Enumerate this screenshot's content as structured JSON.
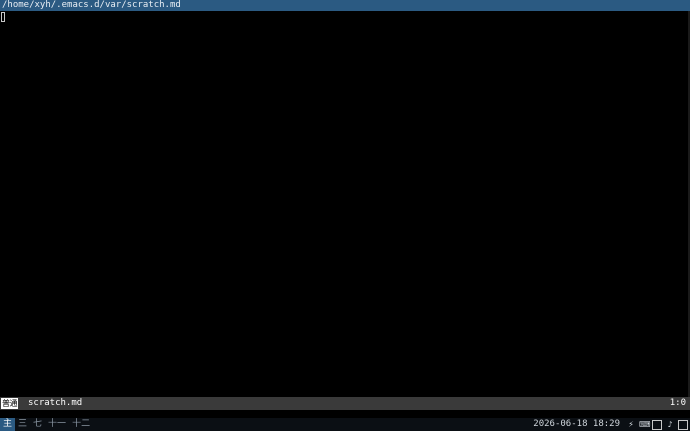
{
  "window": {
    "title": "/home/xyh/.emacs.d/var/scratch.md"
  },
  "modeline": {
    "mode_indicator": "普通",
    "buffer_name": "scratch.md",
    "position": "1:0"
  },
  "taskbar": {
    "workspaces": [
      {
        "label": "主",
        "active": true
      },
      {
        "label": "三",
        "active": false
      },
      {
        "label": "七",
        "active": false
      },
      {
        "label": "十一",
        "active": false
      },
      {
        "label": "十二",
        "active": false
      }
    ],
    "clock": "2026-06-18 18:29",
    "tray_icons": [
      "power-icon",
      "keyboard-icon",
      "network-icon",
      "volume-icon",
      "battery-icon"
    ]
  },
  "colors": {
    "titlebar_bg": "#2b5a82",
    "modeline_bg": "#3a3a3a",
    "taskbar_bg": "#0b0f14",
    "active_workspace_bg": "#2b5a82"
  }
}
